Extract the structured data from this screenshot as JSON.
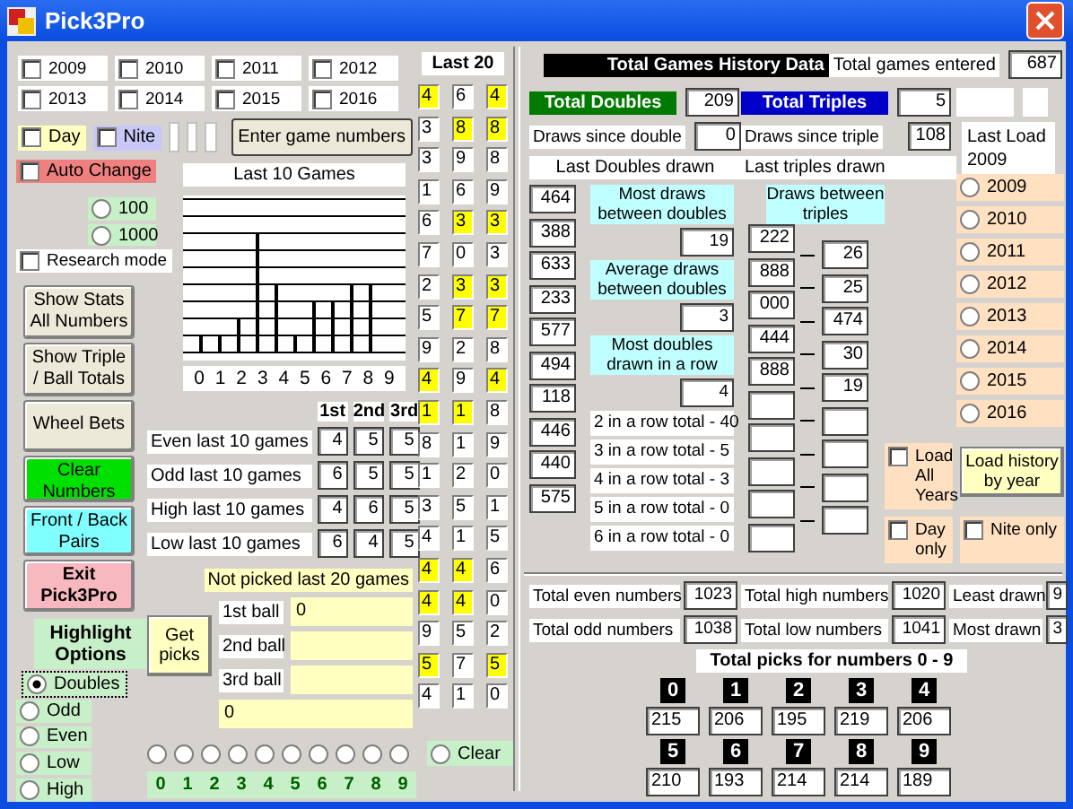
{
  "window": {
    "title": "Pick3Pro"
  },
  "years": [
    {
      "label": "2009",
      "checked": false
    },
    {
      "label": "2010",
      "checked": false
    },
    {
      "label": "2011",
      "checked": false
    },
    {
      "label": "2012",
      "checked": false
    },
    {
      "label": "2013",
      "checked": false
    },
    {
      "label": "2014",
      "checked": false
    },
    {
      "label": "2015",
      "checked": false
    },
    {
      "label": "2016",
      "checked": false
    }
  ],
  "options": [
    {
      "label": "Day",
      "checked": false,
      "color": "#ffffc0"
    },
    {
      "label": "Nite",
      "checked": false,
      "color": "#c8c8f8"
    }
  ],
  "auto_change": {
    "label": "Auto Change",
    "checked": false
  },
  "enter_button": "Enter game numbers",
  "range": [
    {
      "label": "100",
      "selected": false
    },
    {
      "label": "1000",
      "selected": false
    }
  ],
  "research_mode": {
    "label": "Research mode",
    "checked": false
  },
  "buttons": [
    {
      "label": "Show Stats All Numbers",
      "kind": "standard"
    },
    {
      "label": "Show Triple / Ball Totals",
      "kind": "standard"
    },
    {
      "label": "Wheel Bets",
      "kind": "standard"
    },
    {
      "label": "Clear Numbers",
      "kind": "go"
    },
    {
      "label": "Front / Back Pairs",
      "kind": "info"
    },
    {
      "label": "Exit Pick3Pro",
      "kind": "exit"
    }
  ],
  "highlight": {
    "title": "Highlight Options",
    "options": [
      {
        "label": "Doubles",
        "selected": true
      },
      {
        "label": "Odd",
        "selected": false
      },
      {
        "label": "Even",
        "selected": false
      },
      {
        "label": "Low",
        "selected": false
      },
      {
        "label": "High",
        "selected": false
      }
    ]
  },
  "chart": {
    "title": "Last 10 Games",
    "axis": "0 1 2 3 4 5 6 7 8 9"
  },
  "stats": {
    "columns": [
      "1st",
      "2nd",
      "3rd"
    ],
    "rows": [
      {
        "label": "Even last 10 games",
        "values": [
          "4",
          "5",
          "5"
        ]
      },
      {
        "label": "Odd last 10 games",
        "values": [
          "6",
          "5",
          "5"
        ]
      },
      {
        "label": "High last 10 games",
        "values": [
          "4",
          "6",
          "5"
        ]
      },
      {
        "label": "Low last 10 games",
        "values": [
          "6",
          "4",
          "5"
        ]
      }
    ]
  },
  "not_picked": {
    "title": "Not picked last 20 games",
    "button": "Get picks",
    "balls": [
      {
        "label": "1st ball",
        "value": "0"
      },
      {
        "label": "2nd ball"
      },
      {
        "label": "3rd ball"
      }
    ],
    "all": "0"
  },
  "last20": {
    "title": "Last 20",
    "rows": [
      [
        {
          "digit": "4",
          "highlighted": true
        },
        {
          "digit": "6",
          "highlighted": false
        },
        {
          "digit": "4",
          "highlighted": true
        }
      ],
      [
        {
          "digit": "3",
          "highlighted": false
        },
        {
          "digit": "8",
          "highlighted": true
        },
        {
          "digit": "8",
          "highlighted": true
        }
      ],
      [
        {
          "digit": "3",
          "highlighted": false
        },
        {
          "digit": "9",
          "highlighted": false
        },
        {
          "digit": "8",
          "highlighted": false
        }
      ],
      [
        {
          "digit": "1",
          "highlighted": false
        },
        {
          "digit": "6",
          "highlighted": false
        },
        {
          "digit": "9",
          "highlighted": false
        }
      ],
      [
        {
          "digit": "6",
          "highlighted": false
        },
        {
          "digit": "3",
          "highlighted": true
        },
        {
          "digit": "3",
          "highlighted": true
        }
      ],
      [
        {
          "digit": "7",
          "highlighted": false
        },
        {
          "digit": "0",
          "highlighted": false
        },
        {
          "digit": "3",
          "highlighted": false
        }
      ],
      [
        {
          "digit": "2",
          "highlighted": false
        },
        {
          "digit": "3",
          "highlighted": true
        },
        {
          "digit": "3",
          "highlighted": true
        }
      ],
      [
        {
          "digit": "5",
          "highlighted": false
        },
        {
          "digit": "7",
          "highlighted": true
        },
        {
          "digit": "7",
          "highlighted": true
        }
      ],
      [
        {
          "digit": "9",
          "highlighted": false
        },
        {
          "digit": "2",
          "highlighted": false
        },
        {
          "digit": "8",
          "highlighted": false
        }
      ],
      [
        {
          "digit": "4",
          "highlighted": true
        },
        {
          "digit": "9",
          "highlighted": false
        },
        {
          "digit": "4",
          "highlighted": true
        }
      ],
      [
        {
          "digit": "1",
          "highlighted": true
        },
        {
          "digit": "1",
          "highlighted": true
        },
        {
          "digit": "8",
          "highlighted": false
        }
      ],
      [
        {
          "digit": "8",
          "highlighted": false
        },
        {
          "digit": "1",
          "highlighted": false
        },
        {
          "digit": "9",
          "highlighted": false
        }
      ],
      [
        {
          "digit": "1",
          "highlighted": false
        },
        {
          "digit": "2",
          "highlighted": false
        },
        {
          "digit": "0",
          "highlighted": false
        }
      ],
      [
        {
          "digit": "3",
          "highlighted": false
        },
        {
          "digit": "5",
          "highlighted": false
        },
        {
          "digit": "1",
          "highlighted": false
        }
      ],
      [
        {
          "digit": "4",
          "highlighted": false
        },
        {
          "digit": "1",
          "highlighted": false
        },
        {
          "digit": "5",
          "highlighted": false
        }
      ],
      [
        {
          "digit": "4",
          "highlighted": true
        },
        {
          "digit": "4",
          "highlighted": true
        },
        {
          "digit": "6",
          "highlighted": false
        }
      ],
      [
        {
          "digit": "4",
          "highlighted": true
        },
        {
          "digit": "4",
          "highlighted": true
        },
        {
          "digit": "0",
          "highlighted": false
        }
      ],
      [
        {
          "digit": "9",
          "highlighted": false
        },
        {
          "digit": "5",
          "highlighted": false
        },
        {
          "digit": "2",
          "highlighted": false
        }
      ],
      [
        {
          "digit": "5",
          "highlighted": true
        },
        {
          "digit": "7",
          "highlighted": false
        },
        {
          "digit": "5",
          "highlighted": true
        }
      ],
      [
        {
          "digit": "4",
          "highlighted": false
        },
        {
          "digit": "1",
          "highlighted": false
        },
        {
          "digit": "0",
          "highlighted": false
        }
      ]
    ]
  },
  "digit_selectors": [
    {
      "label": "0",
      "selected": false
    },
    {
      "label": "1",
      "selected": false
    },
    {
      "label": "2",
      "selected": false
    },
    {
      "label": "3",
      "selected": false
    },
    {
      "label": "4",
      "selected": false
    },
    {
      "label": "5",
      "selected": false
    },
    {
      "label": "6",
      "selected": false
    },
    {
      "label": "7",
      "selected": false
    },
    {
      "label": "8",
      "selected": false
    },
    {
      "label": "9",
      "selected": false
    }
  ],
  "clear_selector": {
    "label": "Clear",
    "selected": false
  },
  "history": {
    "title": "Total Games History Data",
    "games_label": "Total games entered",
    "games": "687"
  },
  "doubles": {
    "title": "Total Doubles",
    "total": "209",
    "since_label": "Draws since double",
    "since": "0",
    "last_label": "Last Doubles drawn",
    "last": [
      "464",
      "388",
      "633",
      "233",
      "577",
      "494",
      "118",
      "446",
      "440",
      "575"
    ],
    "stats": [
      {
        "label": "Most draws between doubles",
        "value": "19"
      },
      {
        "label": "Average draws between doubles",
        "value": "3"
      },
      {
        "label": "Most doubles drawn in a row",
        "value": "4"
      }
    ],
    "in_a_row": [
      "2 in a row total - 40",
      "3 in a row total - 5",
      "4 in a row total - 3",
      "5 in a row total - 0",
      "6 in a row total - 0"
    ]
  },
  "triples": {
    "title": "Total Triples",
    "total": "5",
    "since_label": "Draws since triple",
    "since": "108",
    "last_label": "Last triples drawn",
    "between_label": "Draws between triples",
    "last": [
      "222",
      "888",
      "000",
      "444",
      "888"
    ],
    "between": [
      "26",
      "25",
      "474",
      "30",
      "19"
    ]
  },
  "last_load": "Last Load 2009",
  "year_loads": [
    {
      "label": "2009",
      "selected": false
    },
    {
      "label": "2010",
      "selected": false
    },
    {
      "label": "2011",
      "selected": false
    },
    {
      "label": "2012",
      "selected": false
    },
    {
      "label": "2013",
      "selected": false
    },
    {
      "label": "2014",
      "selected": false
    },
    {
      "label": "2015",
      "selected": false
    },
    {
      "label": "2016",
      "selected": false
    }
  ],
  "load_all": {
    "label": "Load All Years",
    "checked": false
  },
  "load_button": "Load history by year",
  "day_only": {
    "label": "Day only",
    "checked": false
  },
  "nite_only": {
    "label": "Nite only",
    "checked": false
  },
  "totals": [
    {
      "label": "Total even numbers",
      "value": "1023"
    },
    {
      "label": "Total high numbers",
      "value": "1020"
    },
    {
      "label": "Least drawn",
      "value": "9"
    },
    {
      "label": "Total odd numbers",
      "value": "1038"
    },
    {
      "label": "Total low numbers",
      "value": "1041"
    },
    {
      "label": "Most drawn",
      "value": "3"
    }
  ],
  "picks": {
    "title": "Total picks for numbers 0 - 9",
    "numbers": [
      {
        "digit": "0",
        "count": "215"
      },
      {
        "digit": "1",
        "count": "206"
      },
      {
        "digit": "2",
        "count": "195"
      },
      {
        "digit": "3",
        "count": "219"
      },
      {
        "digit": "4",
        "count": "206"
      },
      {
        "digit": "5",
        "count": "210"
      },
      {
        "digit": "6",
        "count": "193"
      },
      {
        "digit": "7",
        "count": "214"
      },
      {
        "digit": "8",
        "count": "214"
      },
      {
        "digit": "9",
        "count": "189"
      }
    ]
  }
}
